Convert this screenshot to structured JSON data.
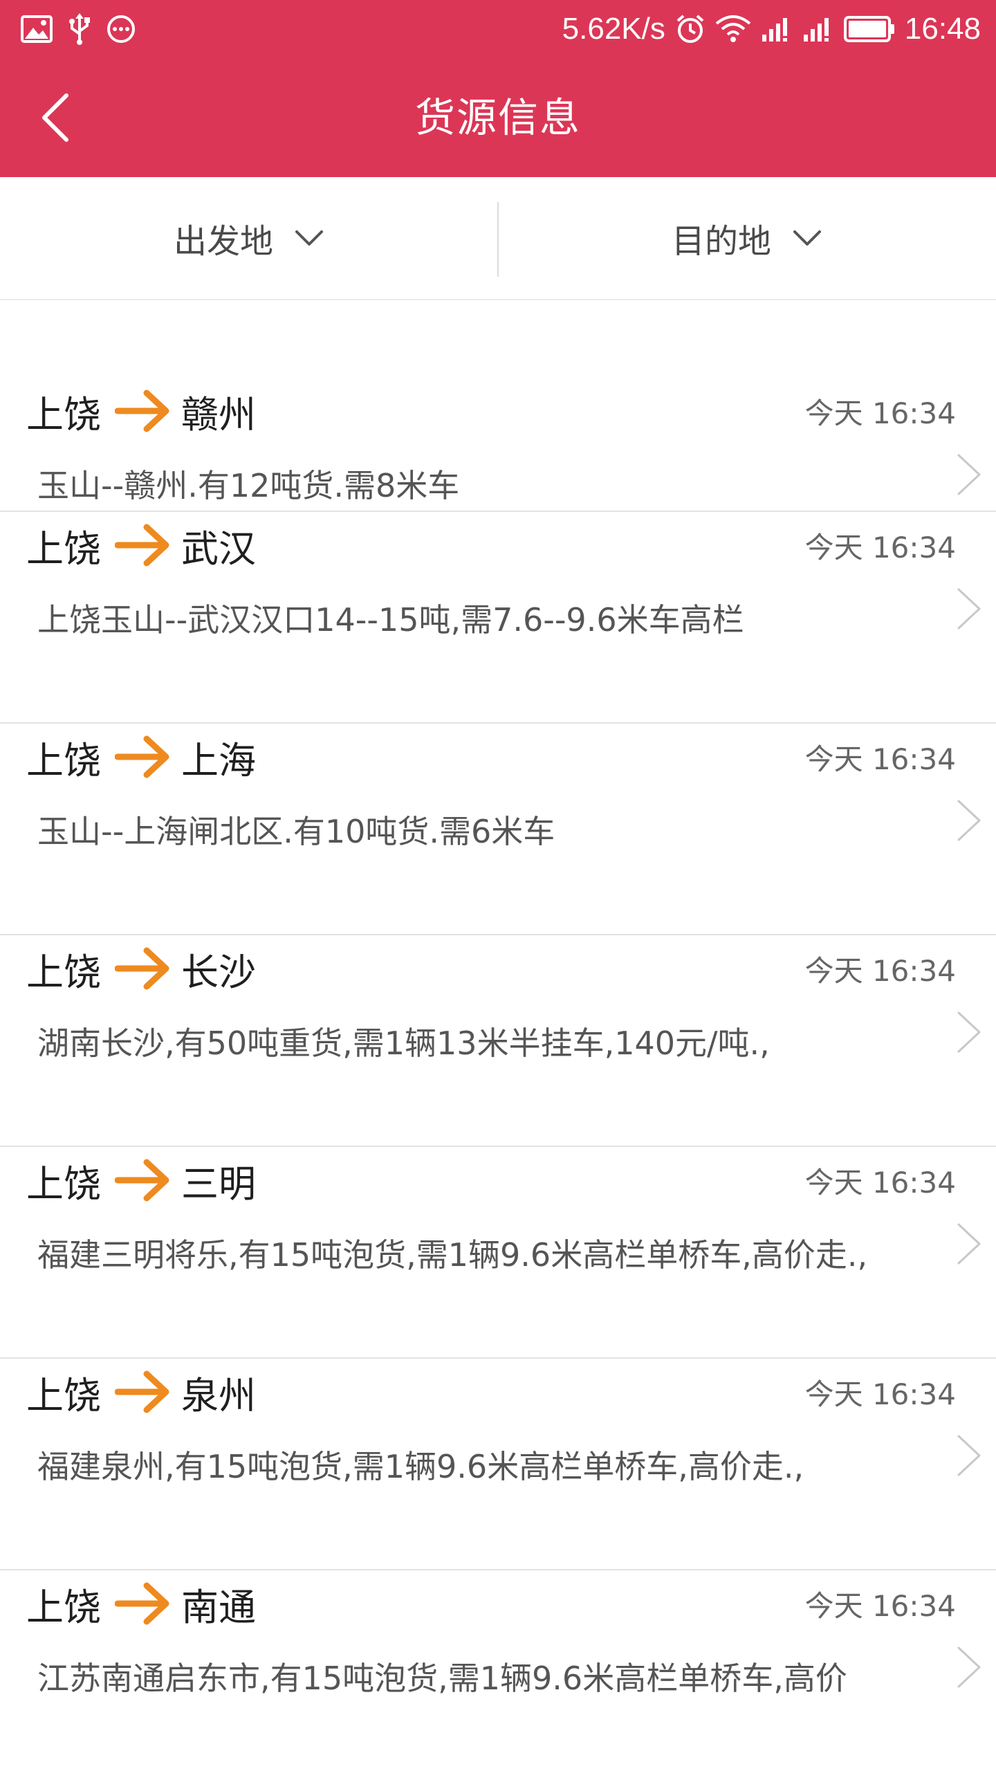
{
  "status_bar": {
    "network_speed": "5.62K/s",
    "time": "16:48",
    "left_icons": [
      "image-icon",
      "usb-icon",
      "more-icon"
    ],
    "right_icons": [
      "alarm-icon",
      "wifi-icon",
      "signal-icon",
      "signal-icon",
      "battery-icon"
    ]
  },
  "header": {
    "title": "货源信息",
    "back_icon": "back-arrow-icon",
    "background_color": "#dc3656"
  },
  "filters": {
    "origin_label": "出发地",
    "destination_label": "目的地",
    "dropdown_icon": "chevron-down-icon"
  },
  "listings": [
    {
      "from": "上饶",
      "to": "赣州",
      "time": "今天 16:34",
      "desc": "玉山--赣州.有12吨货.需8米车"
    },
    {
      "from": "上饶",
      "to": "武汉",
      "time": "今天 16:34",
      "desc": "上饶玉山--武汉汉口14--15吨,需7.6--9.6米车高栏"
    },
    {
      "from": "上饶",
      "to": "上海",
      "time": "今天 16:34",
      "desc": "玉山--上海闸北区.有10吨货.需6米车"
    },
    {
      "from": "上饶",
      "to": "长沙",
      "time": "今天 16:34",
      "desc": "湖南长沙,有50吨重货,需1辆13米半挂车,140元/吨.,"
    },
    {
      "from": "上饶",
      "to": "三明",
      "time": "今天 16:34",
      "desc": "福建三明将乐,有15吨泡货,需1辆9.6米高栏单桥车,高价走.,"
    },
    {
      "from": "上饶",
      "to": "泉州",
      "time": "今天 16:34",
      "desc": "福建泉州,有15吨泡货,需1辆9.6米高栏单桥车,高价走.,"
    },
    {
      "from": "上饶",
      "to": "南通",
      "time": "今天 16:34",
      "desc": "江苏南通启东市,有15吨泡货,需1辆9.6米高栏单桥车,高价"
    }
  ],
  "colors": {
    "accent": "#dc3656",
    "arrow": "#ee8a1f"
  }
}
